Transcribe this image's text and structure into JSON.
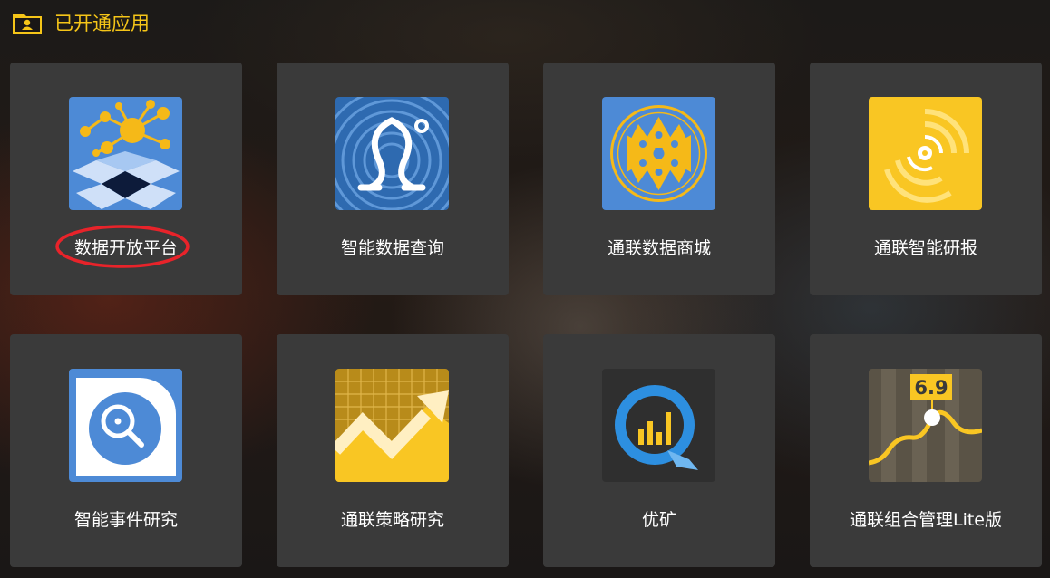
{
  "header": {
    "title": "已开通应用",
    "icon": "folder-user-icon"
  },
  "apps": [
    {
      "label": "数据开放平台",
      "icon": "data-network-icon",
      "highlighted": true
    },
    {
      "label": "智能数据查询",
      "icon": "omega-wave-icon"
    },
    {
      "label": "通联数据商城",
      "icon": "snowflake-badge-icon"
    },
    {
      "label": "通联智能研报",
      "icon": "radar-circle-icon"
    },
    {
      "label": "智能事件研究",
      "icon": "magnifier-icon"
    },
    {
      "label": "通联策略研究",
      "icon": "trend-arrow-icon"
    },
    {
      "label": "优矿",
      "icon": "q-bars-icon"
    },
    {
      "label": "通联组合管理Lite版",
      "icon": "line-score-icon",
      "badge": "6.9"
    }
  ],
  "colors": {
    "accent": "#f5c518",
    "tile": "#3a3a3a",
    "highlight": "#e8232a"
  }
}
